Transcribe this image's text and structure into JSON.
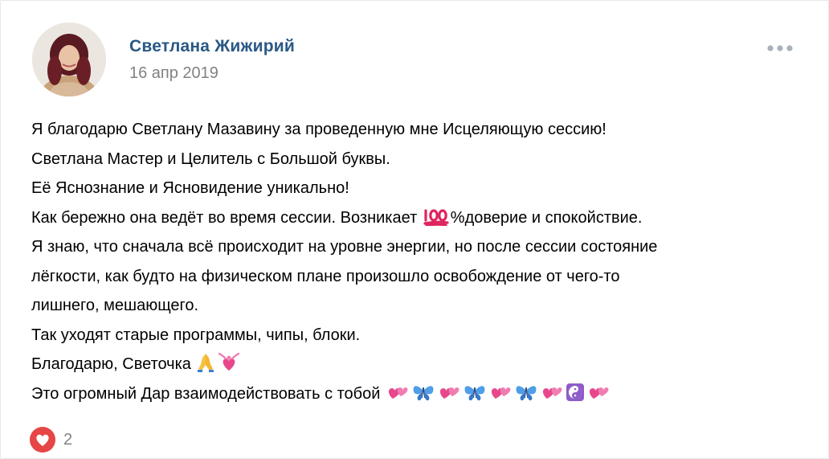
{
  "post": {
    "author": "Светлана Жижирий",
    "date": "16 апр 2019",
    "menu_icon": "more-horizontal-icon",
    "lines": {
      "l1": "Я благодарю Светлану Мазавину за проведенную мне Исцеляющую сессию!",
      "l2": "Светлана Мастер и Целитель с Большой буквы.",
      "l3": "Её Яснознание и Ясновидение уникально!",
      "l4a": "Как бережно она ведёт во время сессии. Возникает",
      "l4b": "%доверие и спокойствие.",
      "l5": "Я знаю, что сначала всё происходит на уровне энергии, но после сессии состояние",
      "l6": "лёгкости, как будто на физическом плане произошло освобождение от чего-то",
      "l7": "лишнего, мешающего.",
      "l8": "Так уходят старые программы, чипы, блоки.",
      "l9": "Благодарю, Светочка",
      "l10": "Это огромный Дар взаимодействовать с тобой"
    },
    "emoji": {
      "hundred": "hundred-points-emoji",
      "pray": "folded-hands-emoji",
      "heart_ribbon": "heart-with-ribbon-emoji",
      "two_hearts": "two-hearts-emoji",
      "butterfly": "butterfly-emoji",
      "yin_yang": "yin-yang-emoji"
    },
    "likes": {
      "icon": "heart-icon",
      "count": "2"
    },
    "colors": {
      "author": "#2a5885",
      "secondary": "#828282",
      "like": "#e64646"
    }
  }
}
